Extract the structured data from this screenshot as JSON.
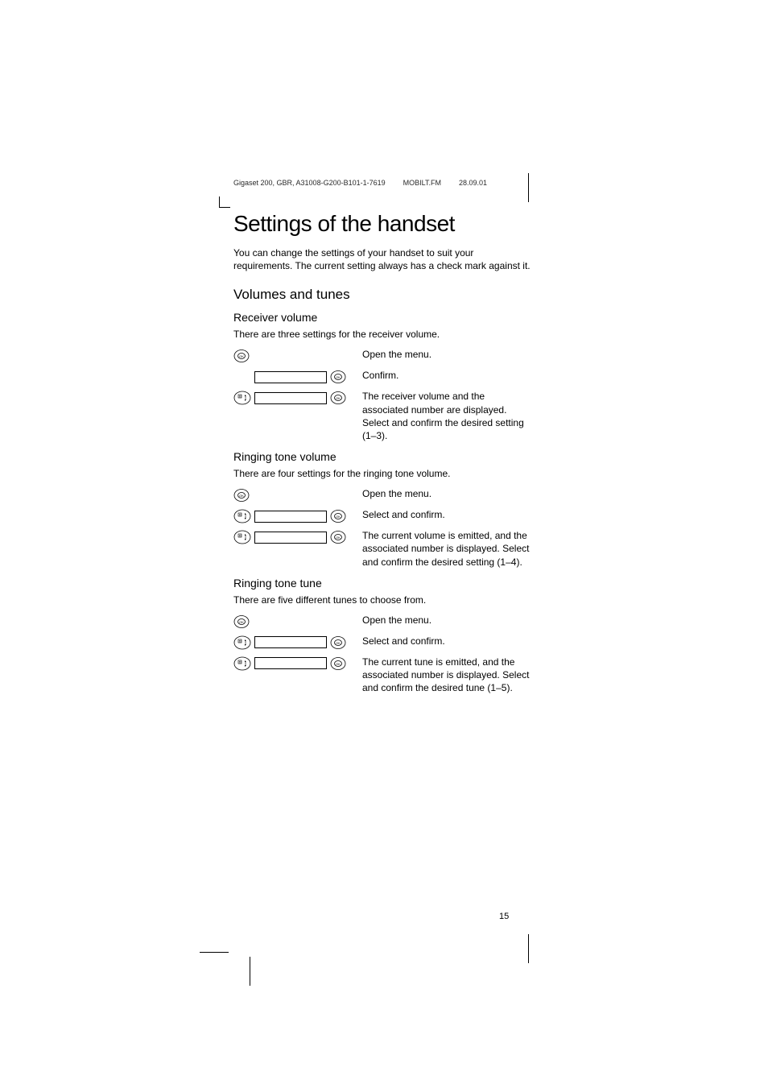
{
  "header": {
    "doc": "Gigaset 200, GBR, A31008-G200-B101-1-7619",
    "file": "MOBILT.FM",
    "date": "28.09.01"
  },
  "title": "Settings of the handset",
  "intro": "You can change the settings of your handset to suit your requirements. The current setting always has a check mark against it.",
  "section1": {
    "heading": "Volumes and tunes",
    "sub1": {
      "heading": "Receiver volume",
      "intro": "There are three settings for the receiver volume.",
      "step1": "Open the menu.",
      "step2": "Confirm.",
      "step3": "The receiver volume and the associated number are displayed. Select and confirm the desired setting (1–3)."
    },
    "sub2": {
      "heading": "Ringing tone volume",
      "intro": "There are four settings for the ringing tone volume.",
      "step1": "Open the menu.",
      "step2": "Select and confirm.",
      "step3": "The current volume is emitted, and the associated number is displayed. Select and confirm the desired setting (1–4)."
    },
    "sub3": {
      "heading": "Ringing tone tune",
      "intro": "There are five different tunes to choose from.",
      "step1": "Open the menu.",
      "step2": "Select and confirm.",
      "step3": "The current tune is emitted, and the associated number is displayed. Select and confirm the desired tune (1–5)."
    }
  },
  "page_number": "15",
  "icons": {
    "ok": "ok-icon",
    "nav": "nav-icon"
  }
}
